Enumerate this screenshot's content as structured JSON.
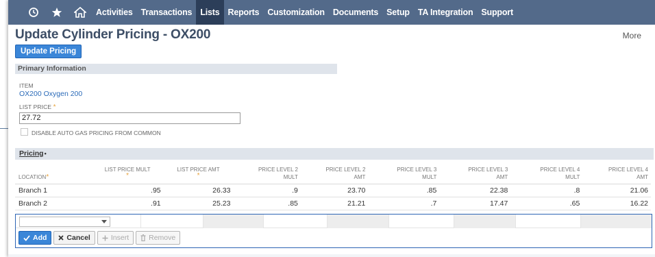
{
  "nav": {
    "icons": [
      "recent-icon",
      "star-icon",
      "home-icon"
    ],
    "items": [
      {
        "label": "Activities",
        "active": false
      },
      {
        "label": "Transactions",
        "active": false
      },
      {
        "label": "Lists",
        "active": true
      },
      {
        "label": "Reports",
        "active": false
      },
      {
        "label": "Customization",
        "active": false
      },
      {
        "label": "Documents",
        "active": false
      },
      {
        "label": "Setup",
        "active": false
      },
      {
        "label": "TA Integration",
        "active": false
      },
      {
        "label": "Support",
        "active": false
      }
    ]
  },
  "header": {
    "title": "Update Cylinder Pricing - OX200",
    "more": "More",
    "update_button": "Update Pricing"
  },
  "primary": {
    "section_title": "Primary Information",
    "item_label": "ITEM",
    "item_value": "OX200 Oxygen 200",
    "list_price_label": "LIST PRICE",
    "list_price_value": "27.72",
    "required_mark": "*",
    "disable_label": "DISABLE AUTO GAS PRICING FROM COMMON"
  },
  "pricing": {
    "title": "Pricing",
    "marker": "•",
    "columns": [
      {
        "line1": "LOCATION",
        "line2": "",
        "req": true
      },
      {
        "line1": "LIST PRICE MULT",
        "line2": "",
        "req": true
      },
      {
        "line1": "LIST PRICE AMT",
        "line2": "",
        "req": true
      },
      {
        "line1": "PRICE LEVEL 2",
        "line2": "MULT",
        "req": false
      },
      {
        "line1": "PRICE LEVEL 2",
        "line2": "AMT",
        "req": false
      },
      {
        "line1": "PRICE LEVEL 3",
        "line2": "MULT",
        "req": false
      },
      {
        "line1": "PRICE LEVEL 3",
        "line2": "AMT",
        "req": false
      },
      {
        "line1": "PRICE LEVEL 4",
        "line2": "MULT",
        "req": false
      },
      {
        "line1": "PRICE LEVEL 4",
        "line2": "AMT",
        "req": false
      }
    ],
    "rows": [
      [
        "Branch 1",
        ".95",
        "26.33",
        ".9",
        "23.70",
        ".85",
        "22.38",
        ".8",
        "21.06"
      ],
      [
        "Branch 2",
        ".91",
        "25.23",
        ".85",
        "21.21",
        ".7",
        "17.47",
        ".65",
        "16.22"
      ]
    ],
    "buttons": {
      "add": "Add",
      "cancel": "Cancel",
      "insert": "Insert",
      "remove": "Remove"
    }
  },
  "colors": {
    "nav_bg": "#536a8a",
    "nav_active": "#2c3e59",
    "primary_button": "#3b86d8",
    "title": "#3d4e66",
    "link": "#2a6ab8",
    "required": "#e8a33d"
  }
}
